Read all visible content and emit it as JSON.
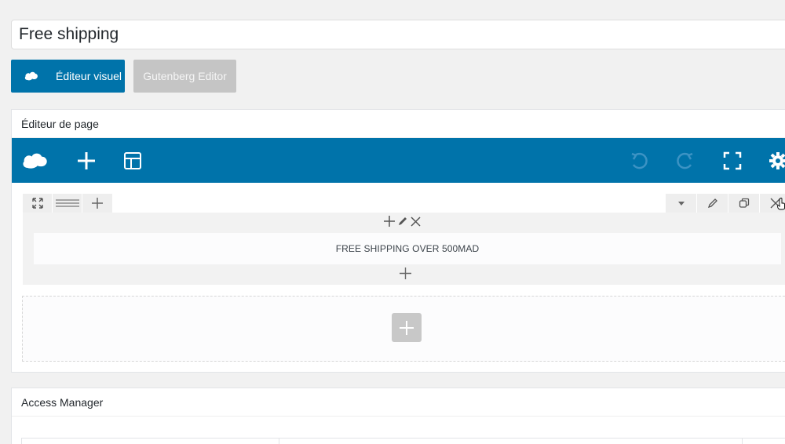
{
  "title_field": {
    "value": "Free shipping"
  },
  "editor_switch": {
    "visual_label": "Éditeur visuel",
    "gutenberg_label": "Gutenberg Editor"
  },
  "page_editor": {
    "heading": "Éditeur de page",
    "toolbar_icons": [
      "logo-icon",
      "add-icon",
      "layout-icon",
      "undo-icon",
      "redo-icon",
      "fullscreen-icon",
      "settings-icon"
    ],
    "row_tools_left": [
      "expand-icon",
      "drag-handle-icon",
      "add-column-icon"
    ],
    "row_tools_right": [
      "chevron-down-icon",
      "edit-icon",
      "duplicate-icon",
      "close-icon"
    ],
    "text_block": "FREE SHIPPING OVER 500MAD"
  },
  "access_manager": {
    "heading": "Access Manager"
  },
  "colors": {
    "primary": "#0073aa",
    "disabled_button": "#c5c5c5",
    "background": "#f1f1f1"
  }
}
